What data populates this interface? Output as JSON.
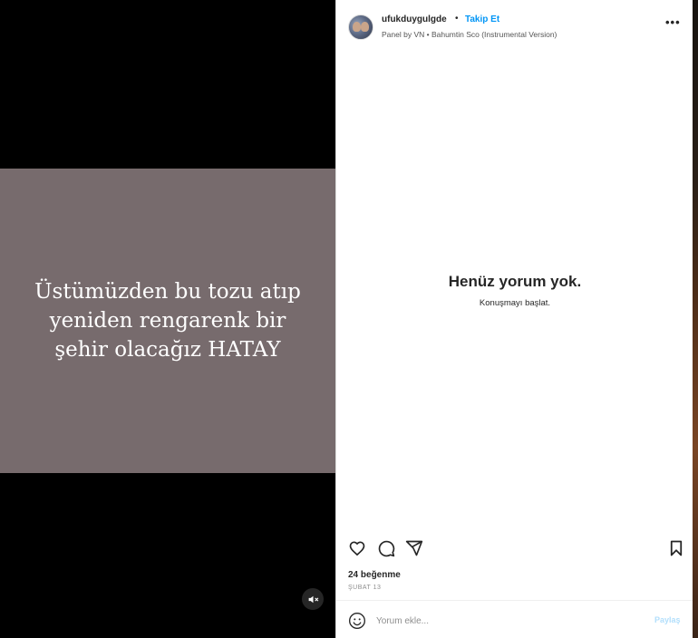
{
  "media": {
    "caption_text": "Üstümüzden bu tozu atıp\nyeniden rengarenk bir\nşehir olacağız HATAY",
    "frame_color": "#776b6d",
    "mute_icon": "muted-speaker-icon"
  },
  "header": {
    "username": "ufukduygulgde",
    "separator": "•",
    "follow_label": "Takip Et",
    "subtitle": "Panel by VN • Bahumtin Sco (Instrumental Version)",
    "more_icon": "more-options-icon",
    "more_label": "•••"
  },
  "comments": {
    "empty_title": "Henüz yorum yok.",
    "empty_subtitle": "Konuşmayı başlat."
  },
  "actions": {
    "icons": [
      "heart-icon",
      "comment-icon",
      "share-icon",
      "bookmark-icon"
    ]
  },
  "stats": {
    "likes": "24 beğenme",
    "date": "ŞUBAT 13"
  },
  "comment_box": {
    "placeholder": "Yorum ekle...",
    "post_label": "Paylaş"
  },
  "colors": {
    "accent": "#0095f6",
    "post_disabled": "#b2dffc",
    "text": "#262626"
  }
}
